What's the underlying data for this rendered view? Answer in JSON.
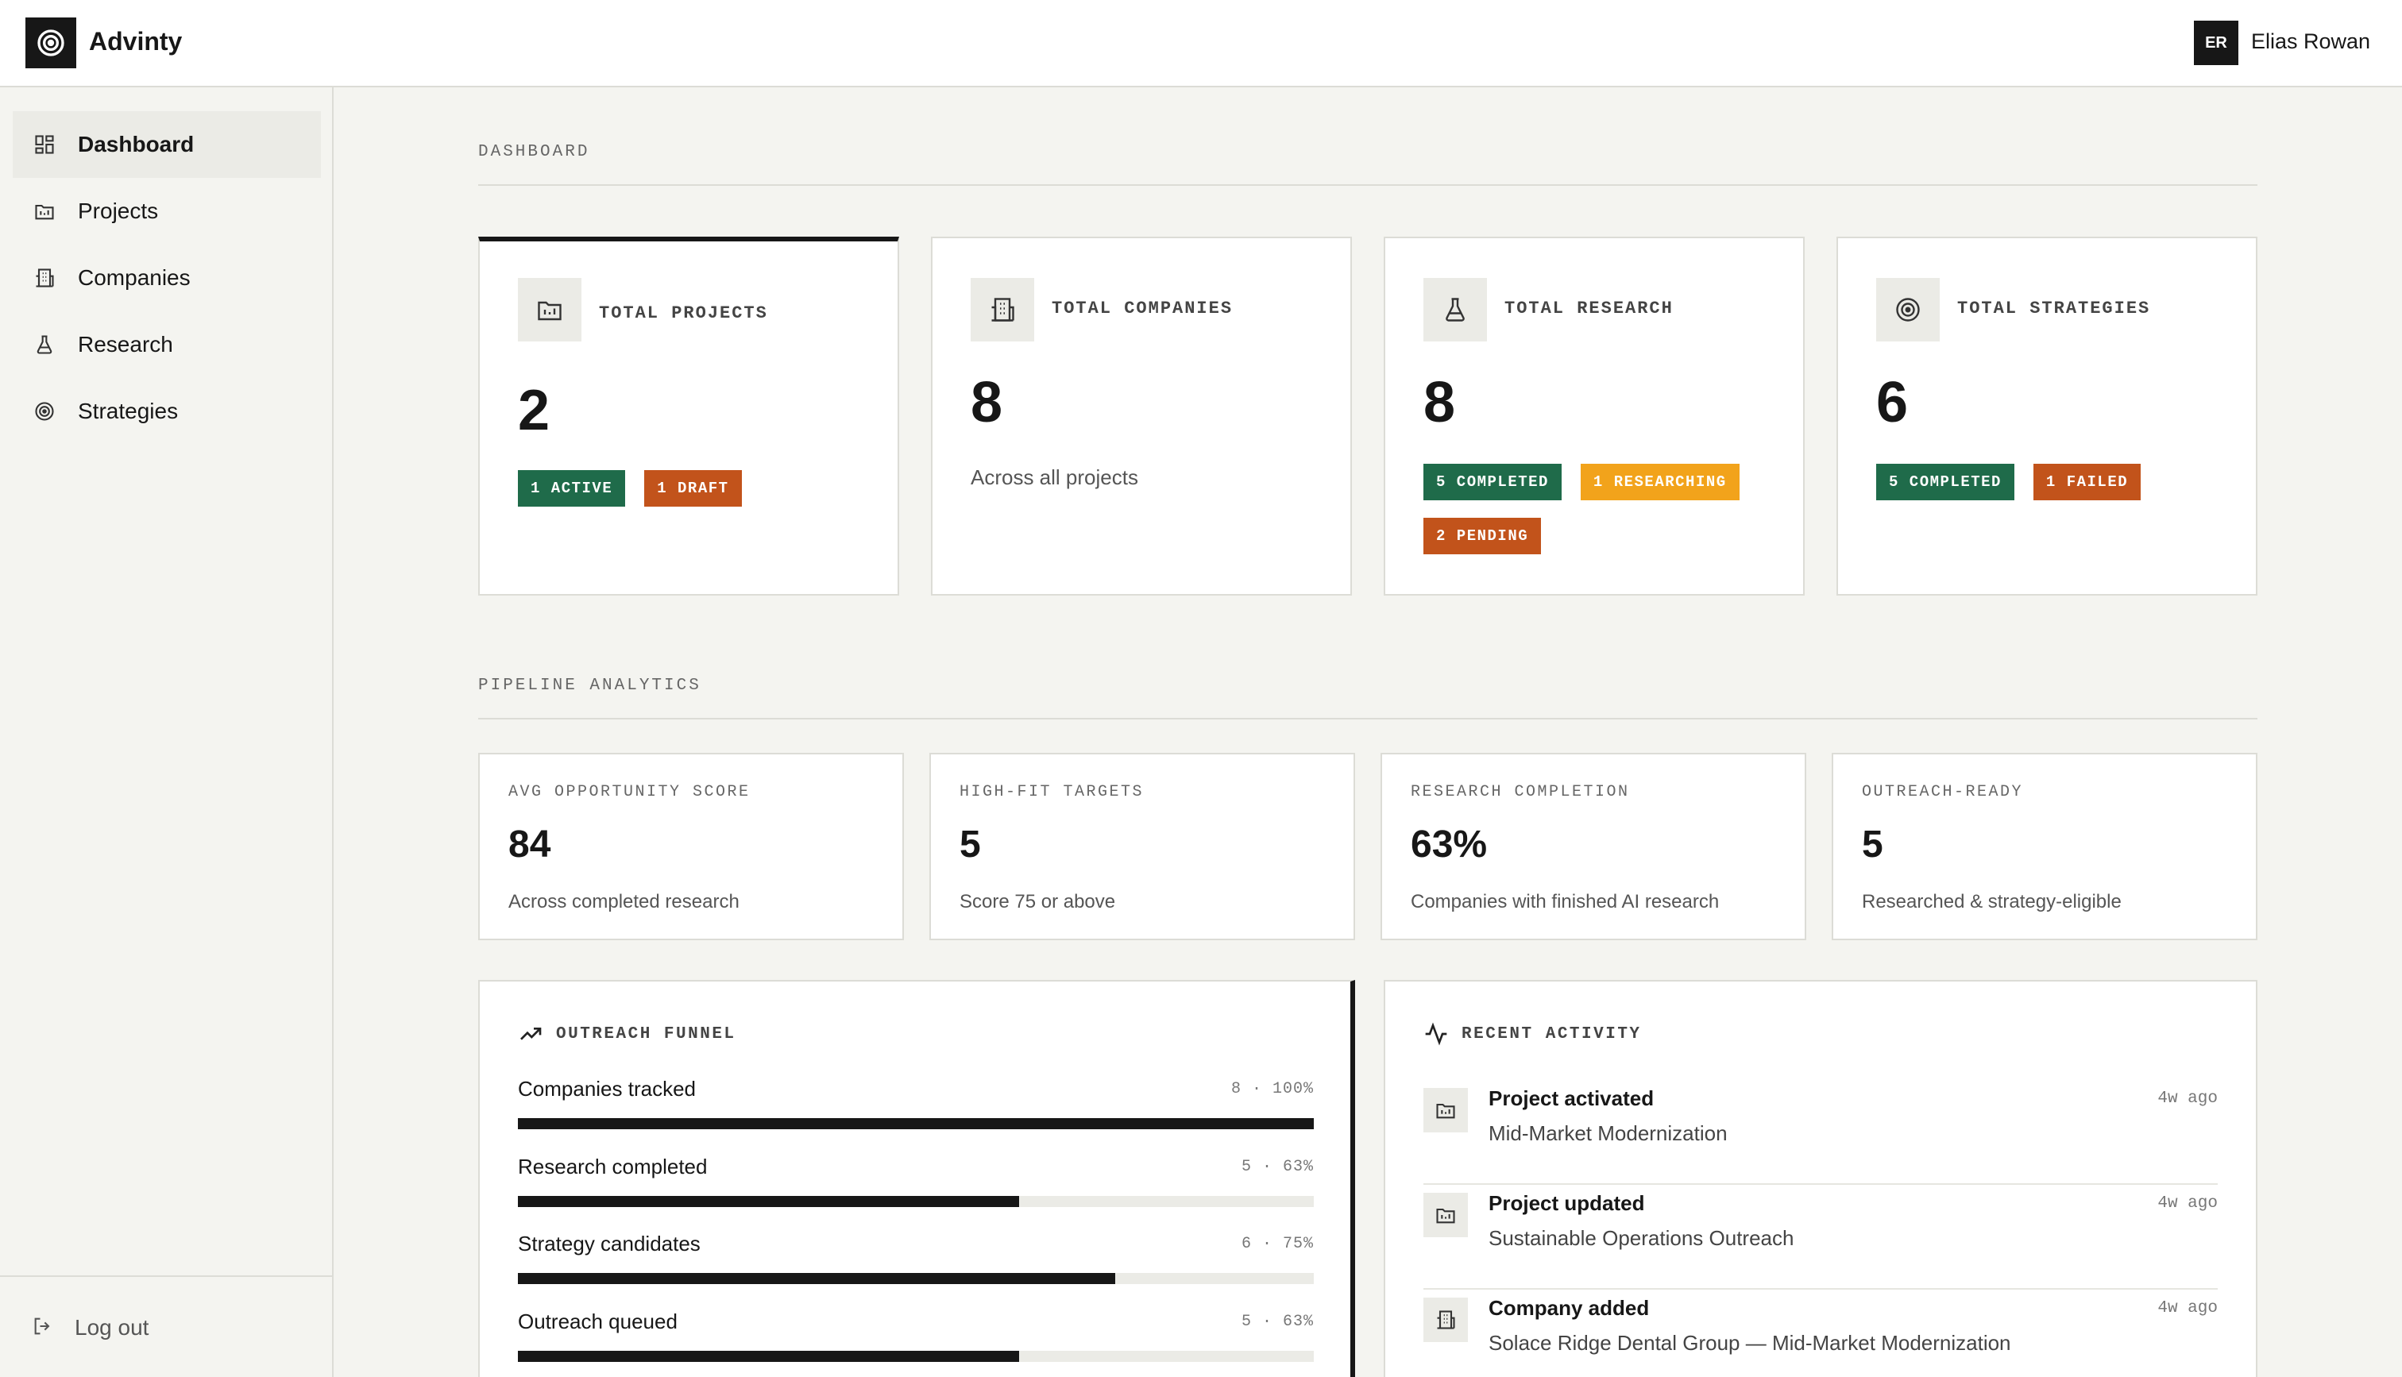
{
  "app": {
    "name": "Advinty"
  },
  "user": {
    "initials": "ER",
    "name": "Elias Rowan"
  },
  "sidebar": {
    "items": [
      {
        "label": "Dashboard",
        "icon": "grid-icon",
        "active": true
      },
      {
        "label": "Projects",
        "icon": "folder-icon",
        "active": false
      },
      {
        "label": "Companies",
        "icon": "building-icon",
        "active": false
      },
      {
        "label": "Research",
        "icon": "flask-icon",
        "active": false
      },
      {
        "label": "Strategies",
        "icon": "target-icon",
        "active": false
      }
    ],
    "logout_label": "Log out"
  },
  "dashboard": {
    "section_title": "DASHBOARD",
    "stats": [
      {
        "label": "TOTAL PROJECTS",
        "value": "2",
        "icon": "folder-icon",
        "badges": [
          {
            "text": "1 ACTIVE",
            "color": "#1f6b4a"
          },
          {
            "text": "1 DRAFT",
            "color": "#c2531b"
          }
        ]
      },
      {
        "label": "TOTAL COMPANIES",
        "value": "8",
        "icon": "building-icon",
        "subtitle": "Across all projects"
      },
      {
        "label": "TOTAL RESEARCH",
        "value": "8",
        "icon": "flask-icon",
        "badges": [
          {
            "text": "5 COMPLETED",
            "color": "#1f6b4a"
          },
          {
            "text": "1 RESEARCHING",
            "color": "#f2a31b"
          },
          {
            "text": "2 PENDING",
            "color": "#c2531b"
          }
        ]
      },
      {
        "label": "TOTAL STRATEGIES",
        "value": "6",
        "icon": "target-icon",
        "badges": [
          {
            "text": "5 COMPLETED",
            "color": "#1f6b4a"
          },
          {
            "text": "1 FAILED",
            "color": "#c2531b"
          }
        ]
      }
    ]
  },
  "pipeline": {
    "section_title": "PIPELINE ANALYTICS",
    "cards": [
      {
        "label": "AVG OPPORTUNITY SCORE",
        "value": "84",
        "desc": "Across completed research"
      },
      {
        "label": "HIGH-FIT TARGETS",
        "value": "5",
        "desc": "Score 75 or above"
      },
      {
        "label": "RESEARCH COMPLETION",
        "value": "63%",
        "desc": "Companies with finished AI research"
      },
      {
        "label": "OUTREACH-READY",
        "value": "5",
        "desc": "Researched & strategy-eligible"
      }
    ]
  },
  "funnel": {
    "title": "OUTREACH FUNNEL",
    "rows": [
      {
        "label": "Companies tracked",
        "stat": "8 · 100%",
        "fraction": 1.0
      },
      {
        "label": "Research completed",
        "stat": "5 · 63%",
        "fraction": 0.63
      },
      {
        "label": "Strategy candidates",
        "stat": "6 · 75%",
        "fraction": 0.75
      },
      {
        "label": "Outreach queued",
        "stat": "5 · 63%",
        "fraction": 0.63
      }
    ]
  },
  "activity": {
    "title": "RECENT ACTIVITY",
    "items": [
      {
        "title": "Project activated",
        "desc": "Mid-Market Modernization",
        "time": "4w ago",
        "icon": "folder-icon"
      },
      {
        "title": "Project updated",
        "desc": "Sustainable Operations Outreach",
        "time": "4w ago",
        "icon": "folder-icon"
      },
      {
        "title": "Company added",
        "desc": "Solace Ridge Dental Group — Mid-Market Modernization",
        "time": "4w ago",
        "icon": "building-icon"
      }
    ]
  }
}
